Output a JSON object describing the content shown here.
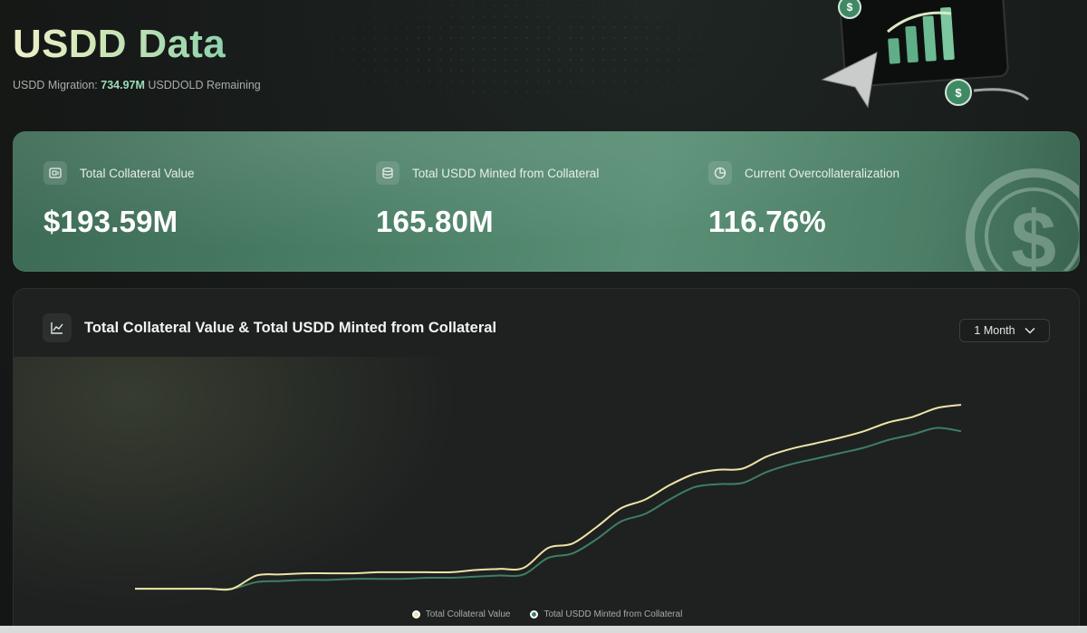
{
  "header": {
    "title": "USDD Data",
    "migration_label": "USDD Migration:",
    "migration_value": "734.97M",
    "migration_suffix": "USDDOLD Remaining"
  },
  "stats": [
    {
      "label": "Total Collateral Value",
      "value": "$193.59M",
      "icon": "vault-icon"
    },
    {
      "label": "Total USDD Minted from Collateral",
      "value": "165.80M",
      "icon": "coin-stack-icon"
    },
    {
      "label": "Current Overcollateralization",
      "value": "116.76%",
      "icon": "pie-chart-icon"
    }
  ],
  "chart_card": {
    "title": "Total Collateral Value & Total USDD Minted from Collateral",
    "range_selected": "1 Month"
  },
  "colors": {
    "accent_green": "#9ddcb9",
    "collateral_line": "#efe3a6",
    "minted_line": "#3f7f63"
  },
  "chart_data": {
    "type": "line",
    "title": "Total Collateral Value & Total USDD Minted from Collateral",
    "xlabel": "",
    "ylabel": "",
    "grid": false,
    "legend": "bottom-center",
    "series": [
      {
        "name": "Total Collateral Value",
        "color": "#efe3a6",
        "values": [
          4,
          4,
          4,
          4,
          4,
          16,
          17,
          18,
          18,
          18,
          19,
          19,
          19,
          19,
          21,
          22,
          23,
          41,
          45,
          60,
          77,
          85,
          98,
          108,
          112,
          113,
          124,
          131,
          136,
          141,
          147,
          155,
          160,
          168,
          171
        ]
      },
      {
        "name": "Total USDD Minted from Collateral",
        "color": "#3f7f63",
        "values": [
          4,
          4,
          4,
          4,
          4,
          10,
          11,
          12,
          12,
          13,
          13,
          13,
          14,
          14,
          15,
          16,
          17,
          32,
          36,
          49,
          65,
          72,
          85,
          96,
          99,
          100,
          110,
          117,
          122,
          127,
          132,
          139,
          144,
          150,
          147
        ]
      }
    ]
  }
}
